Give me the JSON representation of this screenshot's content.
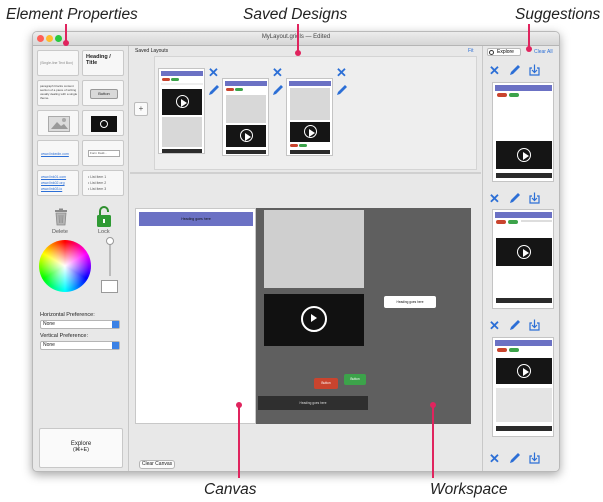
{
  "annotations": {
    "element_properties": "Element Properties",
    "saved_designs": "Saved Designs",
    "suggestions": "Suggestions",
    "canvas": "Canvas",
    "workspace": "Workspace"
  },
  "window": {
    "title": "MyLayout.gridls — Edited"
  },
  "element_palette": {
    "text_input_placeholder": "(Single-line Text Box)",
    "heading_title": "Heading / Title",
    "paragraph_text": "paragraph blocks content section of a piece of writing usually dealing with a single theme.",
    "button_label": "Button",
    "link_text": "www.linkedin.com",
    "text_field_placeholder": "Form Field...",
    "links_list": [
      "www.link01.com",
      "www.link02.org",
      "www.link03.io"
    ],
    "bullets_list": [
      "• List item 1",
      "• List item 2",
      "• List item 3"
    ],
    "delete_label": "Delete",
    "lock_label": "Lock",
    "horizontal_pref_label": "Horizontal Preference:",
    "horizontal_pref_value": "None",
    "vertical_pref_label": "Vertical Preference:",
    "vertical_pref_value": "None",
    "explore_label": "Explore",
    "explore_shortcut": "(⌘+E)"
  },
  "saved_layouts": {
    "title": "Saved Layouts",
    "fit_label": "Fit",
    "add_label": "+"
  },
  "canvas": {
    "heading_text": "Heading goes here",
    "clear_button": "Clear Canvas"
  },
  "workspace": {
    "heading_text": "Heading goes here",
    "bottom_bar_text": "Heading goes here",
    "red_button": "Button",
    "green_button": "Button"
  },
  "suggestions": {
    "explore_tab": "Explore",
    "clear_all": "Clear All"
  },
  "colors": {
    "accent_blue": "#2c6fd6",
    "annotation_red": "#e0245e",
    "heading_bar": "#6b71c4"
  }
}
